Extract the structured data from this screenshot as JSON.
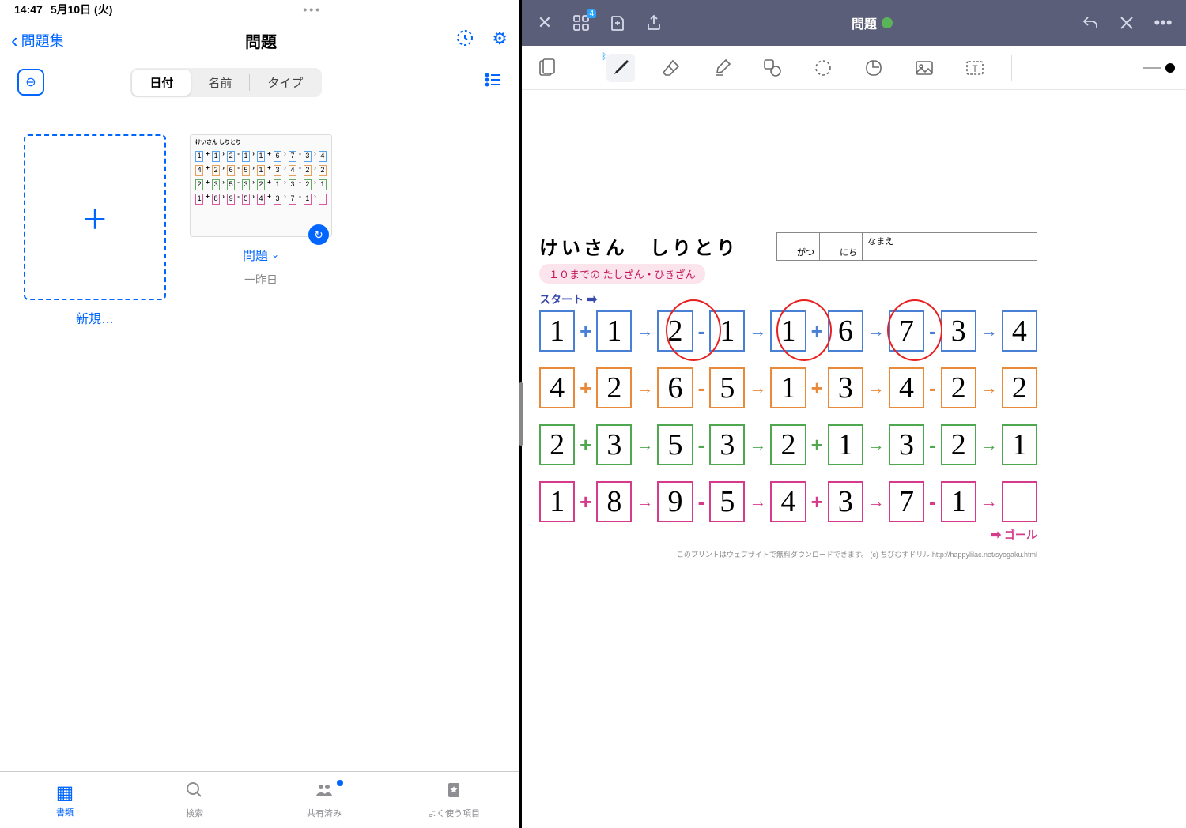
{
  "status": {
    "time": "14:47",
    "date": "5月10日 (火)"
  },
  "left": {
    "back_label": "問題集",
    "title": "問題",
    "segments": {
      "date": "日付",
      "name": "名前",
      "type": "タイプ"
    },
    "new_label": "新規…",
    "doc": {
      "name": "問題",
      "subtitle": "一昨日"
    },
    "tabs": {
      "browse": "書類",
      "search": "検索",
      "shared": "共有済み",
      "favorites": "よく使う項目"
    }
  },
  "right": {
    "title": "問題",
    "badge": "4"
  },
  "worksheet": {
    "title": "けいさん　しりとり",
    "subtitle": "１０までの たしざん・ひきざん",
    "start_label": "スタート",
    "goal_label": "ゴール",
    "name_labels": {
      "month": "がつ",
      "day": "にち",
      "name": "なまえ"
    },
    "rows": [
      {
        "color": "blue",
        "cells": [
          "1",
          "+",
          "1",
          "→",
          "2",
          "-",
          "1",
          "→",
          "1",
          "+",
          "6",
          "→",
          "7",
          "-",
          "3",
          "→",
          "4"
        ]
      },
      {
        "color": "orange",
        "cells": [
          "4",
          "+",
          "2",
          "→",
          "6",
          "-",
          "5",
          "→",
          "1",
          "+",
          "3",
          "→",
          "4",
          "-",
          "2",
          "→",
          "2"
        ]
      },
      {
        "color": "green",
        "cells": [
          "2",
          "+",
          "3",
          "→",
          "5",
          "-",
          "3",
          "→",
          "2",
          "+",
          "1",
          "→",
          "3",
          "-",
          "2",
          "→",
          "1"
        ]
      },
      {
        "color": "pink",
        "cells": [
          "1",
          "+",
          "8",
          "→",
          "9",
          "-",
          "5",
          "→",
          "4",
          "+",
          "3",
          "→",
          "7",
          "-",
          "1",
          "→",
          ""
        ]
      }
    ],
    "handwritten_indices": [
      [
        2,
        4,
        8,
        12,
        16
      ],
      [
        4,
        8,
        12,
        16
      ],
      [
        4,
        8,
        12,
        16
      ],
      [
        4,
        8,
        12,
        16
      ]
    ],
    "circles_row1": [
      2,
      4,
      8
    ],
    "footnote": "このプリントはウェブサイトで無料ダウンロードできます。 (c) ちびむすドリル  http://happylilac.net/syogaku.html"
  }
}
